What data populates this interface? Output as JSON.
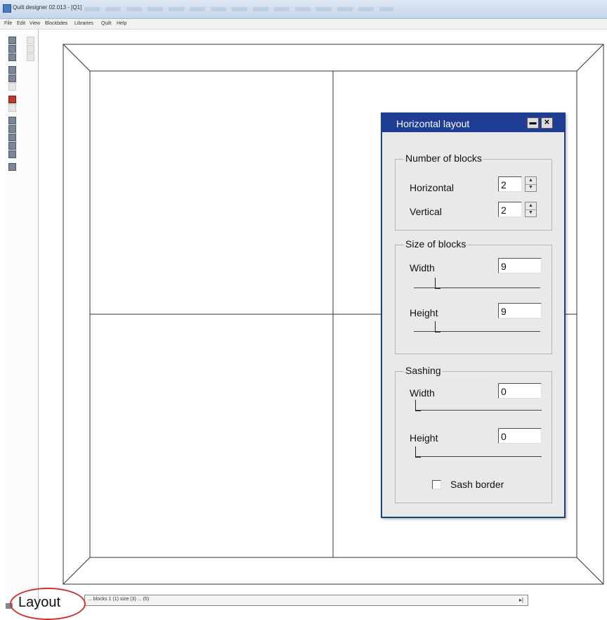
{
  "window": {
    "title": "Quilt designer 02.013 - [Q1]"
  },
  "menu": {
    "items": [
      "File",
      "Edit",
      "View",
      "Blockbdes",
      "Libraries",
      "Quilt",
      "Help"
    ]
  },
  "dialog": {
    "title": "Horizontal layout",
    "minimize_glyph": "▬",
    "close_glyph": "✕",
    "number_of_blocks": {
      "group_title": "Number of blocks",
      "horizontal_label": "Horizontal",
      "horizontal_value": "2",
      "vertical_label": "Vertical",
      "vertical_value": "2"
    },
    "size_of_blocks": {
      "group_title": "Size of blocks",
      "width_label": "Width",
      "width_value": "9",
      "height_label": "Height",
      "height_value": "9"
    },
    "sashing": {
      "group_title": "Sashing",
      "width_label": "Width",
      "width_value": "0",
      "height_label": "Height",
      "height_value": "0",
      "sash_border_label": "Sash border",
      "sash_border_checked": false
    }
  },
  "statusbar": {
    "text": "... blocks 1 (1) size (3) ... (5)",
    "arrow": "▸|"
  },
  "annotation": {
    "label": "Layout"
  },
  "colors": {
    "dialog_title_bg": "#1f3d95",
    "annotation_circle": "#d0312d",
    "window_title_bg": "#c4d5ea"
  }
}
